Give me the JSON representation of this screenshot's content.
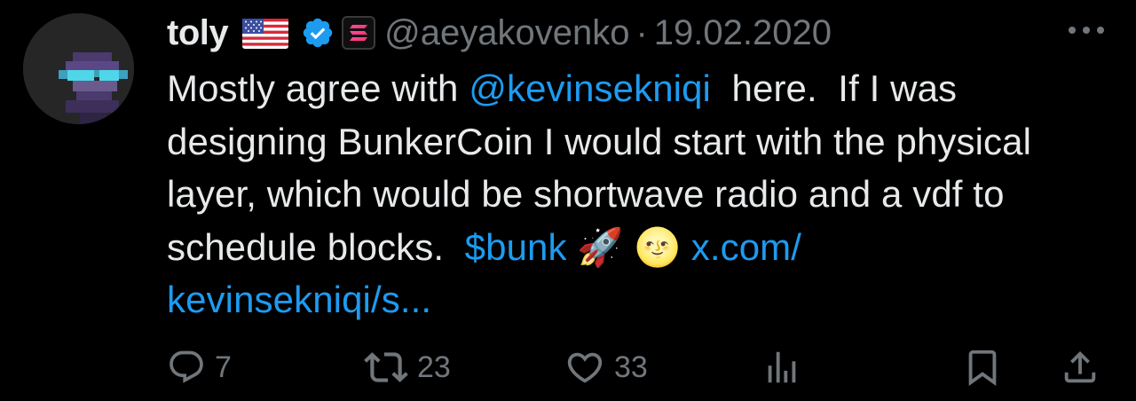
{
  "tweet": {
    "author_name": "toly",
    "handle": "@aeyakovenko",
    "separator": "·",
    "date": "19.02.2020",
    "text_parts": {
      "p1": "Mostly agree with ",
      "mention": "@kevinsekniqi",
      "p2": "  here.  If I was designing BunkerCoin I would start with the physical layer, which would be shortwave radio and a vdf to schedule blocks.  ",
      "cashtag": "$bunk",
      "emoji1": "🚀",
      "emoji2": "🌝",
      "url_part1": "x.com/",
      "url_part2": "kevinsekniqi/s..."
    }
  },
  "actions": {
    "reply_count": "7",
    "retweet_count": "23",
    "like_count": "33"
  },
  "icons": {
    "flag": "us-flag-icon",
    "verified": "verified-badge-icon",
    "affiliate": "solana-affiliate-icon",
    "more": "more-icon",
    "reply": "reply-icon",
    "retweet": "retweet-icon",
    "like": "heart-icon",
    "views": "views-icon",
    "bookmark": "bookmark-icon",
    "share": "share-icon"
  },
  "colors": {
    "background": "#000000",
    "text": "#e7e9ea",
    "secondary": "#71767b",
    "link": "#1d9bf0"
  }
}
